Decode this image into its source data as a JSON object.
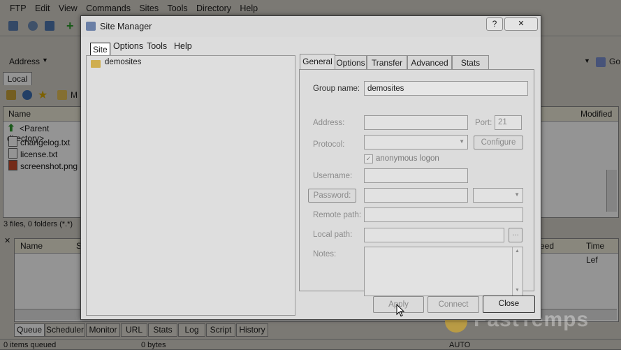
{
  "app": {
    "menu": [
      "FTP",
      "Edit",
      "View",
      "Commands",
      "Sites",
      "Tools",
      "Directory",
      "Help"
    ],
    "address_label": "Address",
    "go_label": "Go",
    "local_tab": "Local",
    "local_path_prefix": "M",
    "columns": {
      "name": "Name",
      "modified": "Modified"
    },
    "files": [
      {
        "name": "<Parent directory>",
        "icon": "up-arrow-icon"
      },
      {
        "name": "changelog.txt",
        "icon": "text-file-icon"
      },
      {
        "name": "license.txt",
        "icon": "text-file-icon"
      },
      {
        "name": "screenshot.png",
        "icon": "image-file-icon"
      }
    ],
    "local_status": "3 files, 0 folders (*.*)",
    "queue_columns": {
      "name": "Name",
      "s": "S",
      "speed": "eed",
      "time_left": "Time Lef"
    },
    "bottom_tabs": [
      "Queue",
      "Scheduler",
      "Monitor",
      "URL",
      "Stats",
      "Log",
      "Script",
      "History"
    ],
    "status": {
      "items": "0 items queued",
      "bytes": "0 bytes",
      "mode": "AUTO"
    },
    "watermark": "FastTemps"
  },
  "dialog": {
    "title": "Site Manager",
    "help_glyph": "?",
    "close_glyph": "✕",
    "menu": [
      "Site",
      "Options",
      "Tools",
      "Help"
    ],
    "tree": [
      {
        "label": "demosites",
        "icon": "folder-icon"
      }
    ],
    "tabs": [
      "General",
      "Options",
      "Transfer",
      "Advanced",
      "Stats"
    ],
    "active_tab": "General",
    "form": {
      "group_name_label": "Group name:",
      "group_name_value": "demosites",
      "address_label": "Address:",
      "address_value": "",
      "port_label": "Port:",
      "port_value": "21",
      "protocol_label": "Protocol:",
      "protocol_value": "",
      "configure_label": "Configure",
      "anonymous_label": "anonymous logon",
      "anonymous_checked": true,
      "username_label": "Username:",
      "password_button": "Password:",
      "remote_path_label": "Remote path:",
      "local_path_label": "Local path:",
      "browse_label": "...",
      "notes_label": "Notes:"
    },
    "buttons": {
      "apply": "Apply",
      "connect": "Connect",
      "close": "Close"
    }
  }
}
